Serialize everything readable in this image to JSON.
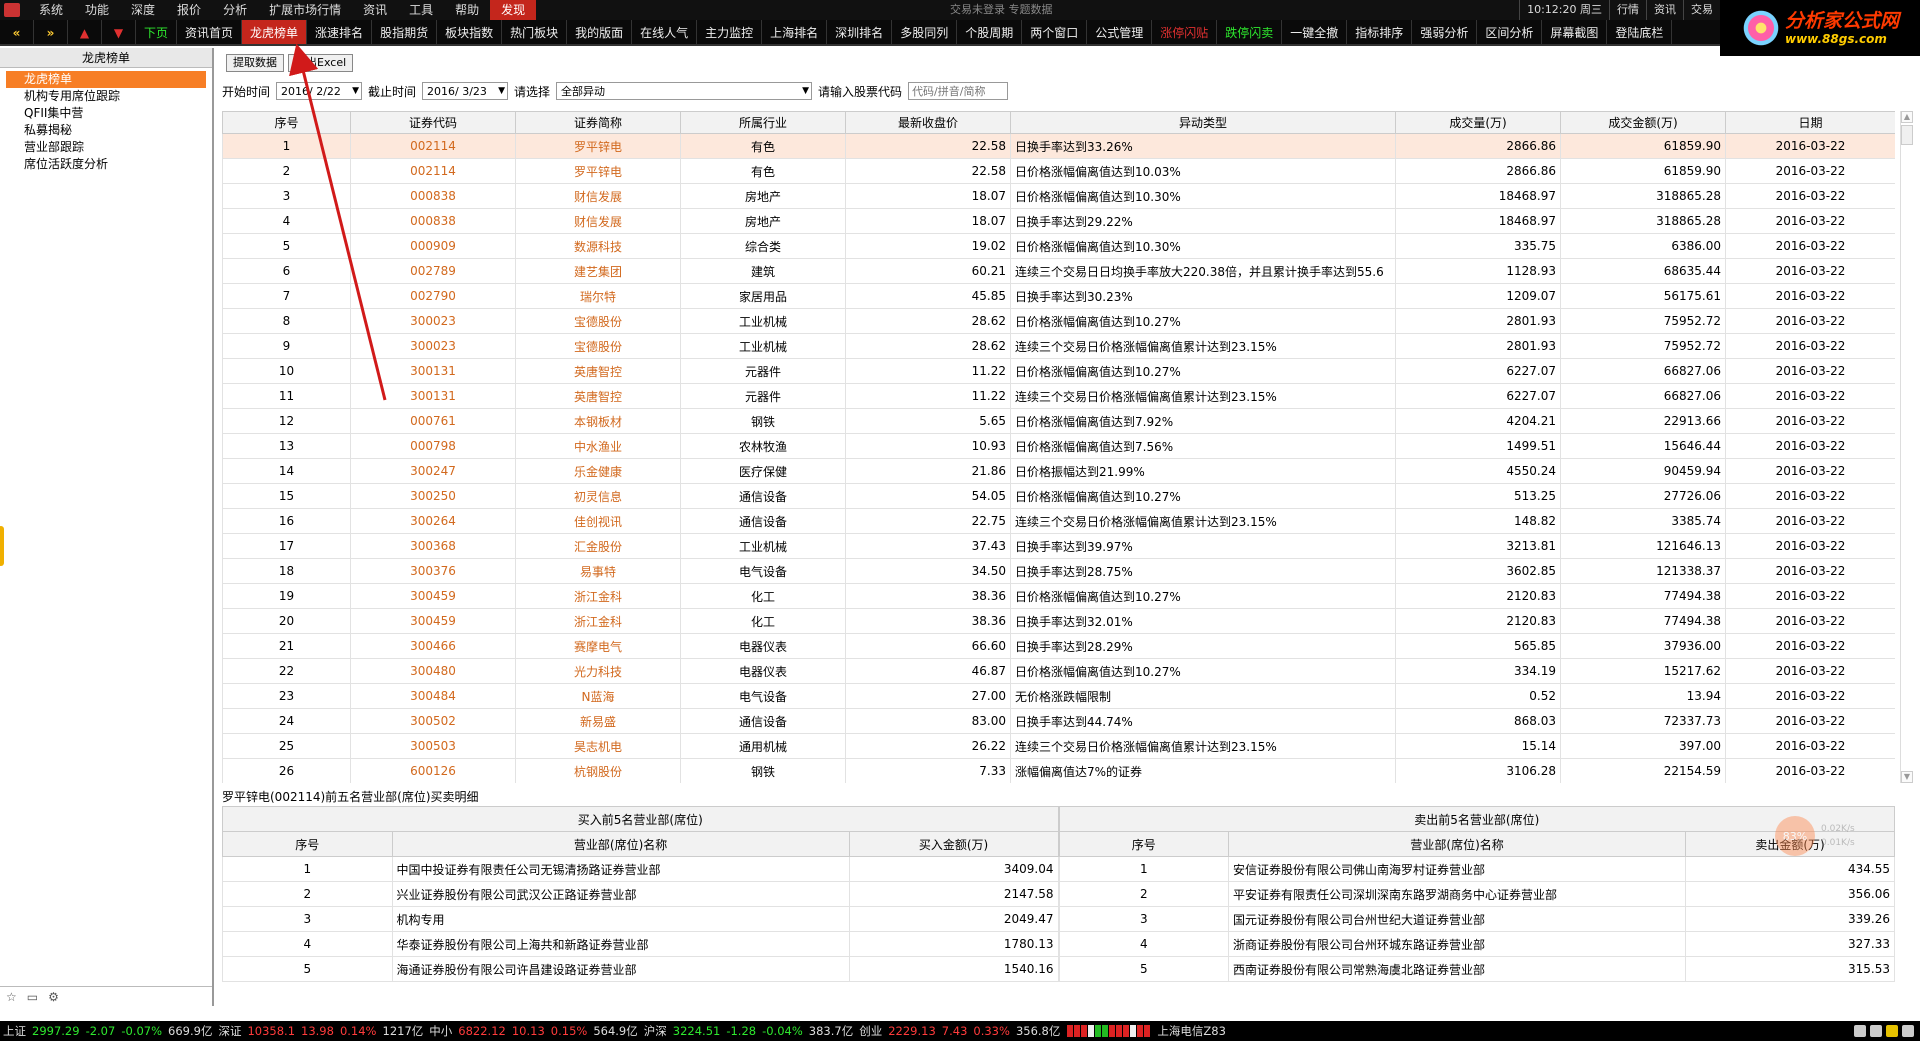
{
  "menu": {
    "items": [
      "系统",
      "功能",
      "深度",
      "报价",
      "分析",
      "扩展市场行情",
      "资讯",
      "工具",
      "帮助",
      "发现"
    ],
    "center_text": "交易未登录  专题数据",
    "time": "10:12:20 周三",
    "right": [
      "行情",
      "资讯",
      "交易"
    ]
  },
  "brand": {
    "name": "分析家公式网",
    "url": "www.88gs.com"
  },
  "toolbar": {
    "nav": [
      "«",
      "»",
      "▲",
      "▼"
    ],
    "page_label": "下页",
    "items": [
      "资讯首页",
      "龙虎榜单",
      "涨速排名",
      "股指期货",
      "板块指数",
      "热门板块",
      "我的版面",
      "在线人气",
      "主力监控",
      "上海排名",
      "深圳排名",
      "多股同列",
      "个股周期",
      "两个窗口",
      "公式管理",
      "涨停闪贴",
      "跌停闪卖",
      "一键全撤",
      "指标排序",
      "强弱分析",
      "区间分析",
      "屏幕截图",
      "登陆底栏"
    ]
  },
  "sidebar": {
    "title": "龙虎榜单",
    "items": [
      "龙虎榜单",
      "机构专用席位跟踪",
      "QFII集中营",
      "私募揭秘",
      "营业部跟踪",
      "席位活跃度分析"
    ]
  },
  "actions": {
    "fetch": "提取数据",
    "export": "导出Excel"
  },
  "filter": {
    "start_label": "开始时间",
    "start_value": "2016/ 2/22",
    "end_label": "截止时间",
    "end_value": "2016/ 3/23",
    "select_label": "请选择",
    "select_value": "全部异动",
    "code_label": "请输入股票代码",
    "code_placeholder": "代码/拼音/简称"
  },
  "table": {
    "headers": [
      "序号",
      "证券代码",
      "证券简称",
      "所属行业",
      "最新收盘价",
      "异动类型",
      "成交量(万)",
      "成交金额(万)",
      "日期"
    ],
    "rows": [
      [
        "1",
        "002114",
        "罗平锌电",
        "有色",
        "22.58",
        "日换手率达到33.26%",
        "2866.86",
        "61859.90",
        "2016-03-22"
      ],
      [
        "2",
        "002114",
        "罗平锌电",
        "有色",
        "22.58",
        "日价格涨幅偏离值达到10.03%",
        "2866.86",
        "61859.90",
        "2016-03-22"
      ],
      [
        "3",
        "000838",
        "财信发展",
        "房地产",
        "18.07",
        "日价格涨幅偏离值达到10.30%",
        "18468.97",
        "318865.28",
        "2016-03-22"
      ],
      [
        "4",
        "000838",
        "财信发展",
        "房地产",
        "18.07",
        "日换手率达到29.22%",
        "18468.97",
        "318865.28",
        "2016-03-22"
      ],
      [
        "5",
        "000909",
        "数源科技",
        "综合类",
        "19.02",
        "日价格涨幅偏离值达到10.30%",
        "335.75",
        "6386.00",
        "2016-03-22"
      ],
      [
        "6",
        "002789",
        "建艺集团",
        "建筑",
        "60.21",
        "连续三个交易日日均换手率放大220.38倍，并且累计换手率达到55.6",
        "1128.93",
        "68635.44",
        "2016-03-22"
      ],
      [
        "7",
        "002790",
        "瑞尔特",
        "家居用品",
        "45.85",
        "日换手率达到30.23%",
        "1209.07",
        "56175.61",
        "2016-03-22"
      ],
      [
        "8",
        "300023",
        "宝德股份",
        "工业机械",
        "28.62",
        "日价格涨幅偏离值达到10.27%",
        "2801.93",
        "75952.72",
        "2016-03-22"
      ],
      [
        "9",
        "300023",
        "宝德股份",
        "工业机械",
        "28.62",
        "连续三个交易日价格涨幅偏离值累计达到23.15%",
        "2801.93",
        "75952.72",
        "2016-03-22"
      ],
      [
        "10",
        "300131",
        "英唐智控",
        "元器件",
        "11.22",
        "日价格涨幅偏离值达到10.27%",
        "6227.07",
        "66827.06",
        "2016-03-22"
      ],
      [
        "11",
        "300131",
        "英唐智控",
        "元器件",
        "11.22",
        "连续三个交易日价格涨幅偏离值累计达到23.15%",
        "6227.07",
        "66827.06",
        "2016-03-22"
      ],
      [
        "12",
        "000761",
        "本钢板材",
        "钢铁",
        "5.65",
        "日价格涨幅偏离值达到7.92%",
        "4204.21",
        "22913.66",
        "2016-03-22"
      ],
      [
        "13",
        "000798",
        "中水渔业",
        "农林牧渔",
        "10.93",
        "日价格涨幅偏离值达到7.56%",
        "1499.51",
        "15646.44",
        "2016-03-22"
      ],
      [
        "14",
        "300247",
        "乐金健康",
        "医疗保健",
        "21.86",
        "日价格振幅达到21.99%",
        "4550.24",
        "90459.94",
        "2016-03-22"
      ],
      [
        "15",
        "300250",
        "初灵信息",
        "通信设备",
        "54.05",
        "日价格涨幅偏离值达到10.27%",
        "513.25",
        "27726.06",
        "2016-03-22"
      ],
      [
        "16",
        "300264",
        "佳创视讯",
        "通信设备",
        "22.75",
        "连续三个交易日价格涨幅偏离值累计达到23.15%",
        "148.82",
        "3385.74",
        "2016-03-22"
      ],
      [
        "17",
        "300368",
        "汇金股份",
        "工业机械",
        "37.43",
        "日换手率达到39.97%",
        "3213.81",
        "121646.13",
        "2016-03-22"
      ],
      [
        "18",
        "300376",
        "易事特",
        "电气设备",
        "34.50",
        "日换手率达到28.75%",
        "3602.85",
        "121338.37",
        "2016-03-22"
      ],
      [
        "19",
        "300459",
        "浙江金科",
        "化工",
        "38.36",
        "日价格涨幅偏离值达到10.27%",
        "2120.83",
        "77494.38",
        "2016-03-22"
      ],
      [
        "20",
        "300459",
        "浙江金科",
        "化工",
        "38.36",
        "日换手率达到32.01%",
        "2120.83",
        "77494.38",
        "2016-03-22"
      ],
      [
        "21",
        "300466",
        "赛摩电气",
        "电器仪表",
        "66.60",
        "日换手率达到28.29%",
        "565.85",
        "37936.00",
        "2016-03-22"
      ],
      [
        "22",
        "300480",
        "光力科技",
        "电器仪表",
        "46.87",
        "日价格涨幅偏离值达到10.27%",
        "334.19",
        "15217.62",
        "2016-03-22"
      ],
      [
        "23",
        "300484",
        "N蓝海",
        "电气设备",
        "27.00",
        "无价格涨跌幅限制",
        "0.52",
        "13.94",
        "2016-03-22"
      ],
      [
        "24",
        "300502",
        "新易盛",
        "通信设备",
        "83.00",
        "日换手率达到44.74%",
        "868.03",
        "72337.73",
        "2016-03-22"
      ],
      [
        "25",
        "300503",
        "昊志机电",
        "通用机械",
        "26.22",
        "连续三个交易日价格涨幅偏离值累计达到23.15%",
        "15.14",
        "397.00",
        "2016-03-22"
      ],
      [
        "26",
        "600126",
        "杭钢股份",
        "钢铁",
        "7.33",
        "涨幅偏离值达7%的证券",
        "3106.28",
        "22154.59",
        "2016-03-22"
      ]
    ]
  },
  "detail": {
    "title": "罗平锌电(002114)前五名营业部(席位)买卖明细",
    "buy_title": "买入前5名营业部(席位)",
    "sell_title": "卖出前5名营业部(席位)",
    "buy_headers": [
      "序号",
      "营业部(席位)名称",
      "买入金额(万)"
    ],
    "sell_headers": [
      "序号",
      "营业部(席位)名称",
      "卖出金额(万)"
    ],
    "buy_rows": [
      [
        "1",
        "中国中投证券有限责任公司无锡清扬路证券营业部",
        "3409.04"
      ],
      [
        "2",
        "兴业证券股份有限公司武汉公正路证券营业部",
        "2147.58"
      ],
      [
        "3",
        "机构专用",
        "2049.47"
      ],
      [
        "4",
        "华泰证券股份有限公司上海共和新路证券营业部",
        "1780.13"
      ],
      [
        "5",
        "海通证券股份有限公司许昌建设路证券营业部",
        "1540.16"
      ]
    ],
    "sell_rows": [
      [
        "1",
        "安信证券股份有限公司佛山南海罗村证券营业部",
        "434.55"
      ],
      [
        "2",
        "平安证券有限责任公司深圳深南东路罗湖商务中心证券营业部",
        "356.06"
      ],
      [
        "3",
        "国元证券股份有限公司台州世纪大道证券营业部",
        "339.26"
      ],
      [
        "4",
        "浙商证券股份有限公司台州环城东路证券营业部",
        "327.33"
      ],
      [
        "5",
        "西南证券股份有限公司常熟海虞北路证券营业部",
        "315.53"
      ]
    ]
  },
  "net": {
    "percent": "83%",
    "up": "0.02K/s",
    "down": "0.01K/s"
  },
  "statusbar": {
    "sh": {
      "name": "上证",
      "value": "2997.29",
      "chg": "-2.07",
      "pct": "-0.07%",
      "amt": "669.9亿"
    },
    "sz": {
      "name": "深证",
      "value": "10358.1",
      "chg": "13.98",
      "pct": "0.14%",
      "amt": "1217亿"
    },
    "zx": {
      "name": "中小",
      "value": "6822.12",
      "chg": "10.13",
      "pct": "0.15%",
      "amt": "564.9亿"
    },
    "hs": {
      "name": "沪深",
      "value": "3224.51",
      "chg": "-1.28",
      "pct": "-0.04%",
      "amt": "383.7亿"
    },
    "cy": {
      "name": "创业",
      "value": "2229.13",
      "chg": "7.43",
      "pct": "0.33%",
      "amt": "356.8亿"
    },
    "server": "上海电信Z83"
  },
  "colors": {
    "accent": "#c4261c",
    "selected": "#f77e25",
    "code_text": "#d2691e",
    "row_highlight": "#fde8dc",
    "annotation_arrow": "#d11a1a"
  }
}
